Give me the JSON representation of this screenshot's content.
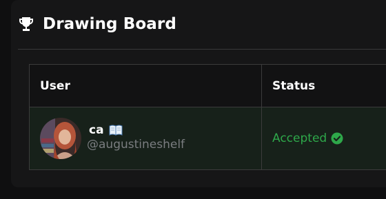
{
  "header": {
    "title": "Drawing Board",
    "icon": "trophy-icon"
  },
  "table": {
    "columns": [
      "User",
      "Status"
    ],
    "rows": [
      {
        "name": "ca",
        "name_icon": "book-icon",
        "handle": "@augustineshelf",
        "status": "Accepted",
        "status_icon": "check-circle-icon"
      }
    ]
  },
  "colors": {
    "background": "#161617",
    "accepted": "#2ea84a",
    "row_background": "#17211a"
  }
}
